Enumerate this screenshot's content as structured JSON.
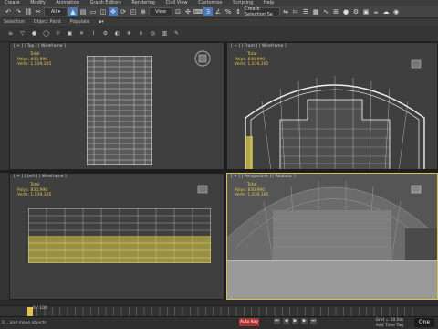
{
  "menu": [
    "Create",
    "Modify",
    "Animation",
    "Graph Editors",
    "Rendering",
    "Civil View",
    "Customize",
    "Scripting",
    "Help"
  ],
  "ribbon": {
    "left": "Selection",
    "items": [
      "Object Paint",
      "Populate"
    ]
  },
  "toolbar": {
    "view_dropdown": "View",
    "selection_dropdown": "Create Selection Se"
  },
  "viewports": {
    "top": {
      "label": "[ + ] [ Top ] [ Wireframe ]"
    },
    "front": {
      "label": "[ + ] [ Front ] [ Wireframe ]"
    },
    "left": {
      "label": "[ + ] [ Left ] [ Wireframe ]"
    },
    "persp": {
      "label": "[ + ] [ Perspective ] [ Realistic ]"
    }
  },
  "stats": {
    "title": "Total",
    "polys_label": "Polys:",
    "polys": "830,990",
    "verts_label": "Verts:",
    "verts": "1,039,305"
  },
  "timeline": {
    "frame": "0 / 100"
  },
  "status": {
    "message": "0 ...and move objects",
    "coord": "Grid = 10.0m",
    "tag": "Add Time Tag",
    "auto_key": "Auto Key"
  },
  "brand": "One"
}
